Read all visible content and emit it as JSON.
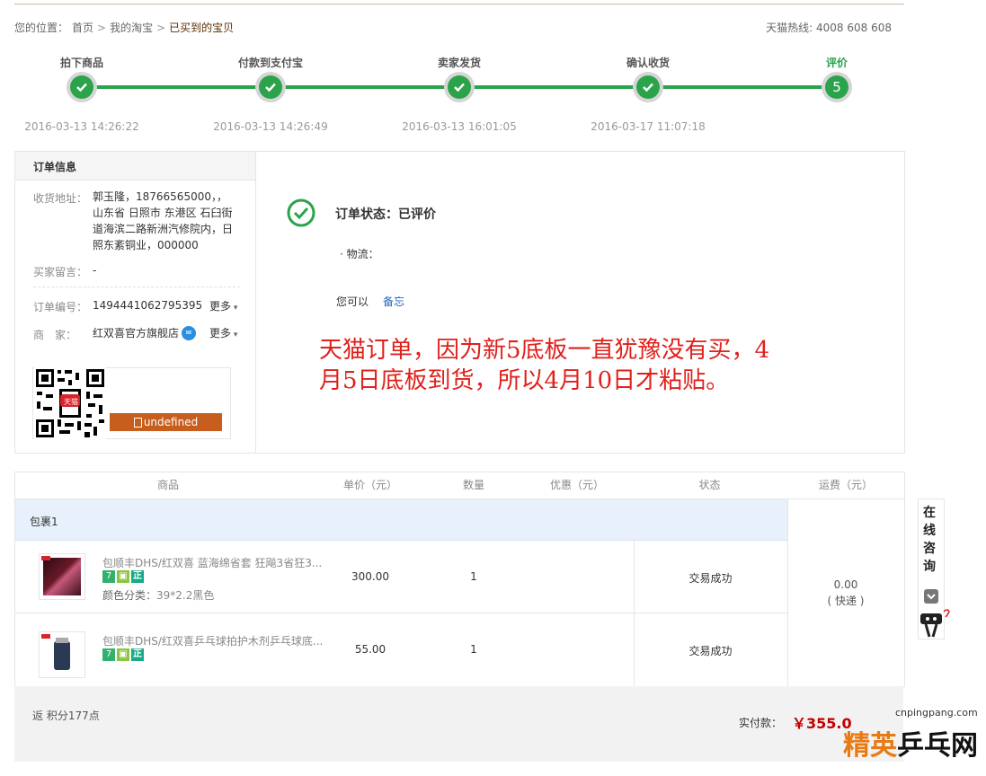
{
  "breadcrumb": {
    "prefix": "您的位置：",
    "items": [
      "首页",
      "我的淘宝",
      "已买到的宝贝"
    ],
    "sep": ">"
  },
  "hotline": "天猫热线: 4008 608 608",
  "progress": {
    "steps": [
      {
        "label": "拍下商品",
        "time": "2016-03-13 14:26:22",
        "done": true
      },
      {
        "label": "付款到支付宝",
        "time": "2016-03-13 14:26:49",
        "done": true
      },
      {
        "label": "卖家发货",
        "time": "2016-03-13 16:01:05",
        "done": true
      },
      {
        "label": "确认收货",
        "time": "2016-03-17 11:07:18",
        "done": true
      },
      {
        "label": "评价",
        "number": "5",
        "done": false
      }
    ],
    "accent": "#2aa34b"
  },
  "order_info": {
    "title": "订单信息",
    "address_label": "收货地址：",
    "address_lines": [
      "郭玉隆，18766565000，，",
      "山东省 日照市 东港区 石臼街",
      "道海滨二路新洲汽修院内，日",
      "照东紊铜业，000000"
    ],
    "message_label": "买家留言：",
    "message_value": "-",
    "order_no_label": "订单编号：",
    "order_no": "1494441062795395",
    "more1": "更多",
    "seller_label": "商　家：",
    "seller": "红双喜官方旗舰店",
    "more2": "更多",
    "qr_button": "undefined",
    "qr_badge": "天猫"
  },
  "status": {
    "text": "订单状态：已评价",
    "logistics": "· 物流：",
    "can_you": "您可以",
    "memo_link": "备忘"
  },
  "annotation": {
    "line1": "天猫订单，因为新5底板一直犹豫没有买，4",
    "line2": "月5日底板到货，所以4月10日才粘贴。"
  },
  "table": {
    "headers": [
      "商品",
      "单价（元）",
      "数量",
      "优惠（元）",
      "状态",
      "运费（元）"
    ],
    "package": "包裹1",
    "items": [
      {
        "name": "包顺丰DHS/红双喜 蓝海绵省套 狂飚3省狂3...",
        "price": "300.00",
        "qty": "1",
        "status": "交易成功",
        "attr_label": "颜色分类：",
        "attr_value": "39*2.2黑色"
      },
      {
        "name": "包顺丰DHS/红双喜乒乓球拍护木剂乒乓球底...",
        "price": "55.00",
        "qty": "1",
        "status": "交易成功"
      }
    ],
    "badges": [
      "7",
      "",
      "正"
    ],
    "shipping_fee": "0.00",
    "shipping_type": "( 快递 )"
  },
  "footer": {
    "points": "返 积分177点",
    "paid_label": "实付款：",
    "paid_value": "￥355.0"
  },
  "consult": {
    "text": "在线咨询"
  },
  "watermark": {
    "url": "cnpingpang.com",
    "brand_a": "精英",
    "brand_b": "乒乓网"
  }
}
